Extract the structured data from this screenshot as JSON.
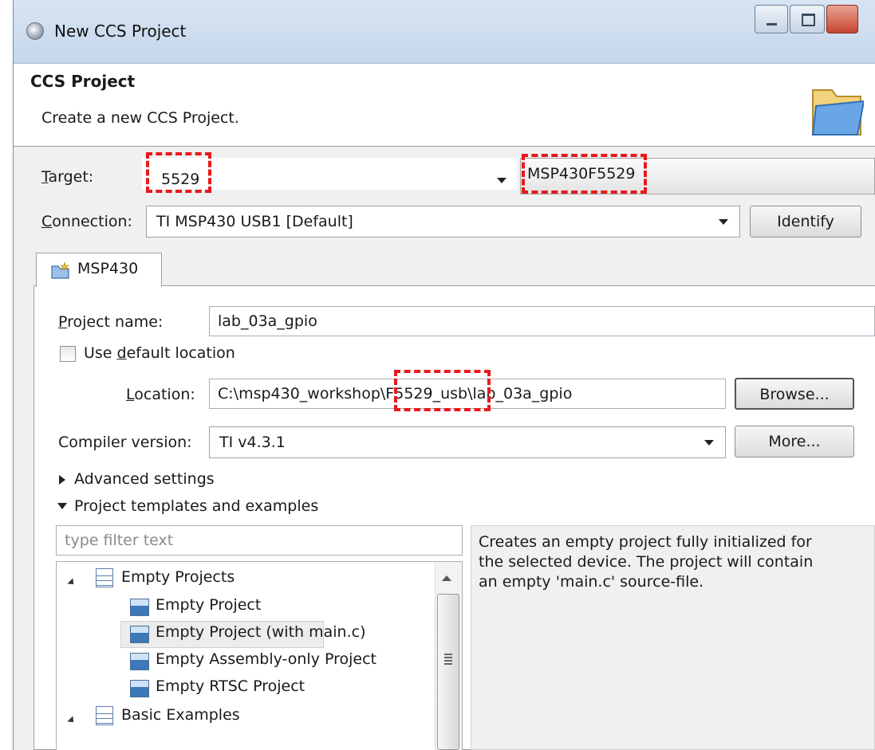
{
  "window": {
    "title": "New CCS Project"
  },
  "header": {
    "title": "CCS Project",
    "description": "Create a new CCS Project."
  },
  "target": {
    "label": "Target:",
    "filter_value": "5529",
    "device_value": "MSP430F5529"
  },
  "connection": {
    "label": "Connection:",
    "value": "TI MSP430 USB1 [Default]",
    "identify_label": "Identify"
  },
  "tab": {
    "label": "MSP430"
  },
  "project": {
    "name_label": "Project name:",
    "name_value": "lab_03a_gpio",
    "use_default_location_label": "Use default location",
    "use_default_location_checked": false,
    "location_label": "Location:",
    "location_value": "C:\\msp430_workshop\\F5529_usb\\lab_03a_gpio",
    "browse_label": "Browse...",
    "compiler_label": "Compiler version:",
    "compiler_value": "TI v4.3.1",
    "more_label": "More..."
  },
  "sections": {
    "advanced": "Advanced settings",
    "templates": "Project templates and examples"
  },
  "templates": {
    "filter_placeholder": "type filter text",
    "tree": [
      {
        "label": "Empty Projects",
        "kind": "group"
      },
      {
        "label": "Empty Project",
        "kind": "item"
      },
      {
        "label": "Empty Project (with main.c)",
        "kind": "item",
        "selected": true
      },
      {
        "label": "Empty Assembly-only Project",
        "kind": "item"
      },
      {
        "label": "Empty RTSC Project",
        "kind": "item"
      },
      {
        "label": "Basic Examples",
        "kind": "group"
      }
    ],
    "description": "Creates an empty project fully initialized for\nthe selected device. The project will contain\nan empty 'main.c' source-file."
  },
  "colors": {
    "annotation": "#e8191b",
    "window_bg": "#f0f0f0"
  }
}
